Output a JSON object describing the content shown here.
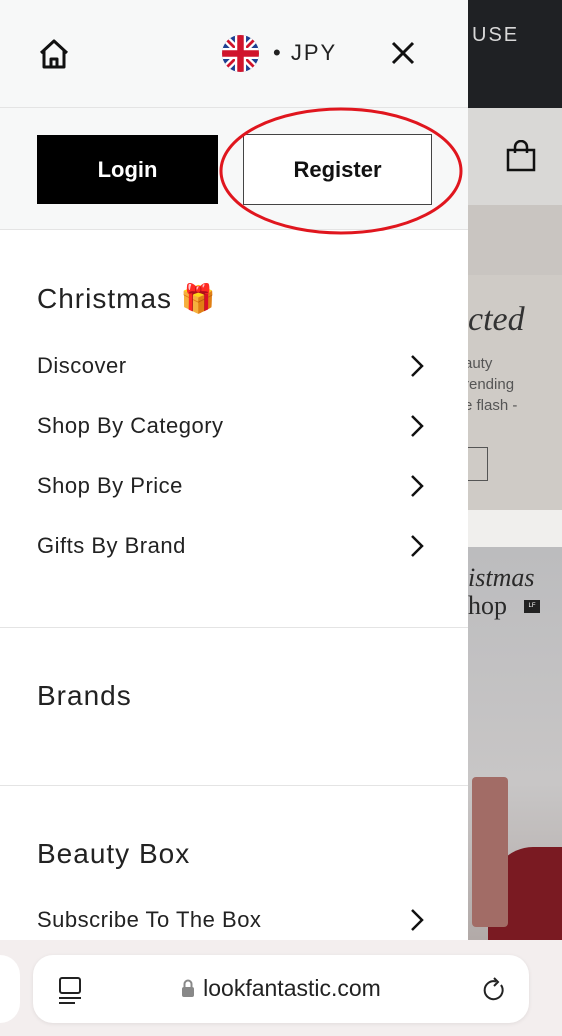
{
  "header": {
    "currency": "• JPY",
    "home_icon": "home-icon",
    "close_icon": "close-icon",
    "flag": "uk-flag-icon"
  },
  "auth": {
    "login_label": "Login",
    "register_label": "Register",
    "highlight_color": "#e0161e"
  },
  "menu": {
    "christmas": {
      "title": "Christmas 🎁",
      "items": [
        {
          "label": "Discover"
        },
        {
          "label": "Shop By Category"
        },
        {
          "label": "Shop By Price"
        },
        {
          "label": "Gifts By Brand"
        }
      ]
    },
    "brands": {
      "title": "Brands"
    },
    "beauty_box": {
      "title": "Beauty Box",
      "items": [
        {
          "label": "Subscribe To The Box"
        }
      ]
    }
  },
  "background_page": {
    "header_text": "USE",
    "banner1_title": "cted",
    "banner1_lines": [
      "auty",
      "rending",
      "e flash -",
      "."
    ],
    "banner2_title": "istmas",
    "banner2_sub": "hop",
    "badge": "LF"
  },
  "browser": {
    "url": "lookfantastic.com"
  }
}
